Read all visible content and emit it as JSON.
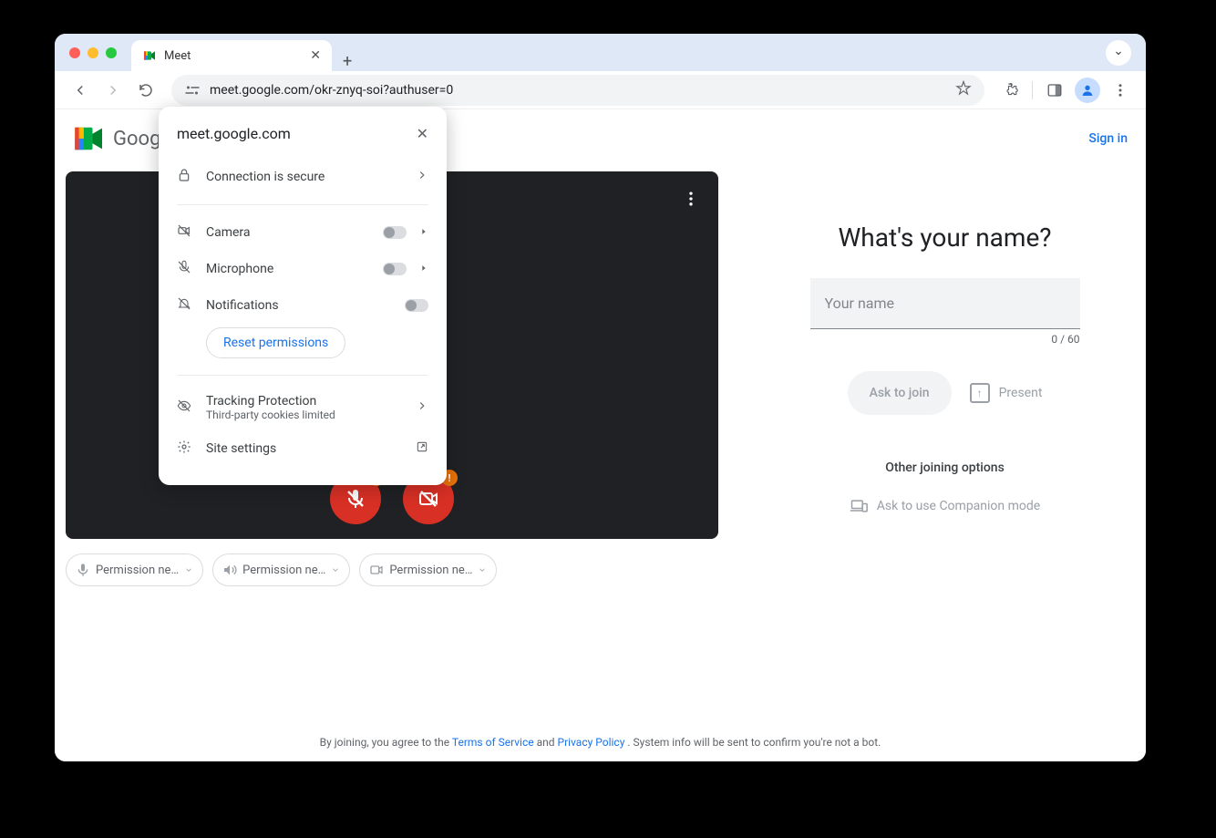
{
  "tab": {
    "title": "Meet"
  },
  "url": "meet.google.com/okr-znyq-soi?authuser=0",
  "header": {
    "product": "Google Meet",
    "signin": "Sign in"
  },
  "popup": {
    "title": "meet.google.com",
    "secure": "Connection is secure",
    "camera": "Camera",
    "microphone": "Microphone",
    "notifications": "Notifications",
    "reset": "Reset permissions",
    "tracking_title": "Tracking Protection",
    "tracking_sub": "Third-party cookies limited",
    "site_settings": "Site settings"
  },
  "preview": {
    "mic_badge": "!",
    "cam_badge": "!"
  },
  "chips": {
    "mic": "Permission ne…",
    "speaker": "Permission ne…",
    "camera": "Permission ne…"
  },
  "join": {
    "heading": "What's your name?",
    "placeholder": "Your name",
    "value": "",
    "counter": "0 / 60",
    "ask": "Ask to join",
    "present": "Present",
    "other": "Other joining options",
    "companion": "Ask to use Companion mode"
  },
  "footer": {
    "prefix": "By joining, you agree to the ",
    "tos": "Terms of Service",
    "and": " and ",
    "privacy": "Privacy Policy",
    "suffix": ". System info will be sent to confirm you're not a bot."
  }
}
